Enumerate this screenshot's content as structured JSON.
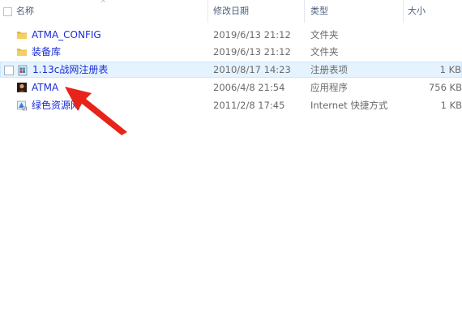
{
  "header": {
    "name_label": "名称",
    "date_label": "修改日期",
    "type_label": "类型",
    "size_label": "大小"
  },
  "files": [
    {
      "name": "ATMA_CONFIG",
      "date": "2019/6/13 21:12",
      "type": "文件夹",
      "size": "",
      "icon": "folder-icon"
    },
    {
      "name": "装备库",
      "date": "2019/6/13 21:12",
      "type": "文件夹",
      "size": "",
      "icon": "folder-icon"
    },
    {
      "name": "1.13c战网注册表",
      "date": "2010/8/17 14:23",
      "type": "注册表项",
      "size": "1 KB",
      "icon": "registry-file-icon"
    },
    {
      "name": "ATMA",
      "date": "2006/4/8 21:54",
      "type": "应用程序",
      "size": "756 KB",
      "icon": "application-icon"
    },
    {
      "name": "绿色资源网",
      "date": "2011/2/8 17:45",
      "type": "Internet 快捷方式",
      "size": "1 KB",
      "icon": "internet-shortcut-icon"
    }
  ],
  "colors": {
    "link": "#1a2cd8",
    "hover_row": "#e5f3ff",
    "annotation_arrow": "#e8231a",
    "folder": "#e8b53c"
  }
}
